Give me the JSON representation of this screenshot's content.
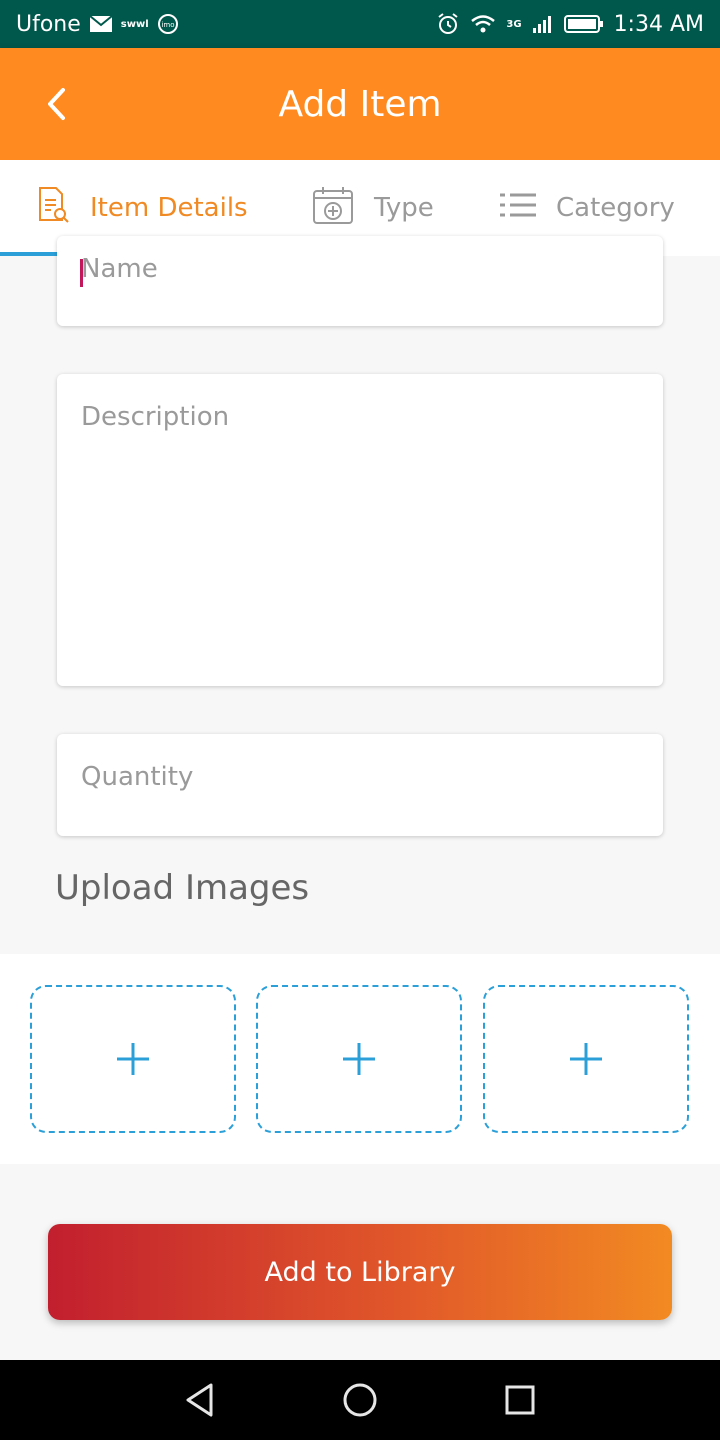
{
  "status_bar": {
    "carrier": "Ufone",
    "swwl_label": "swwl",
    "imo_label": "imo",
    "network": "3G",
    "time": "1:34 AM"
  },
  "app_bar": {
    "title": "Add Item"
  },
  "tabs": [
    {
      "label": "Item Details",
      "icon": "document-search-icon",
      "active": true
    },
    {
      "label": "Type",
      "icon": "calendar-add-icon",
      "active": false
    },
    {
      "label": "Category",
      "icon": "list-icon",
      "active": false
    }
  ],
  "form": {
    "name_placeholder": "Name",
    "description_placeholder": "Description",
    "quantity_placeholder": "Quantity"
  },
  "upload": {
    "title": "Upload Images",
    "slots": [
      "+",
      "+",
      "+"
    ]
  },
  "actions": {
    "add_to_library": "Add to Library"
  },
  "colors": {
    "status_bar": "#00574b",
    "app_bar": "#ff8a1f",
    "active_tab": "#f08a24",
    "tab_indicator": "#2b9fd8",
    "cta_start": "#c21f2e",
    "cta_end": "#f28a22"
  }
}
